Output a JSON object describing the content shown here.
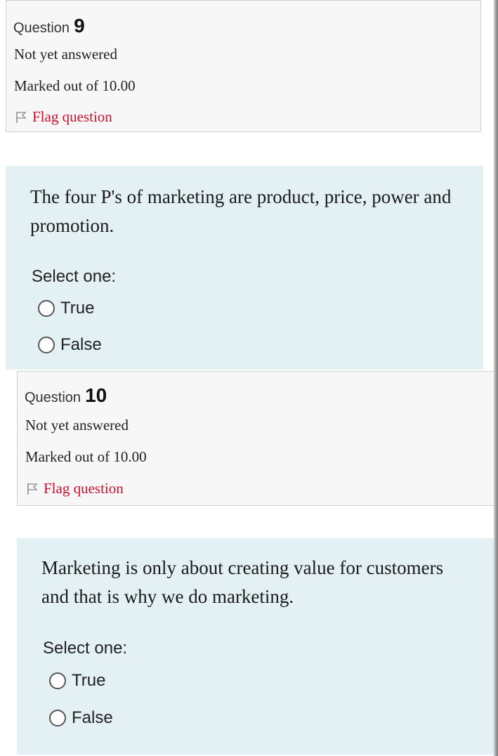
{
  "questions": [
    {
      "label": "Question",
      "number": "9",
      "state": "Not yet answered",
      "grade": "Marked out of 10.00",
      "flag_label": "Flag question",
      "text": "The four P's of marketing are product, price, power and promotion.",
      "prompt": "Select one:",
      "options": [
        "True",
        "False"
      ]
    },
    {
      "label": "Question",
      "number": "10",
      "state": "Not yet answered",
      "grade": "Marked out of 10.00",
      "flag_label": "Flag question",
      "text": "Marketing is only about creating value for customers and that is why we do marketing.",
      "prompt": "Select one:",
      "options": [
        "True",
        "False"
      ]
    }
  ],
  "colors": {
    "flag": "#c8102e",
    "content_bg": "#e3f0f4",
    "info_bg": "#f7f7f7"
  },
  "icons": {
    "flag": "flag-icon",
    "radio": "radio-button-icon"
  }
}
